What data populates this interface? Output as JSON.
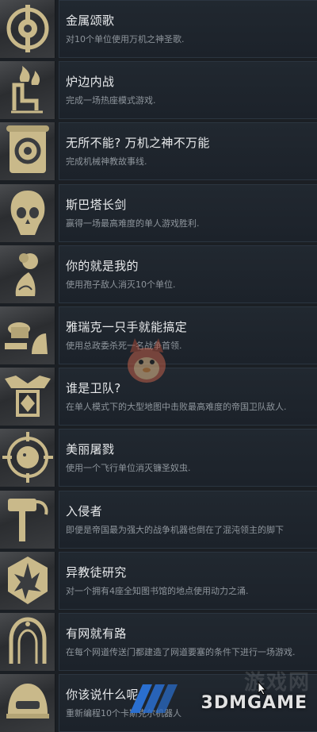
{
  "achievements": [
    {
      "icon": "gear-skull-icon",
      "title": "金属颂歌",
      "description": "对10个单位使用万机之神圣歌."
    },
    {
      "icon": "fire-chair-icon",
      "title": "炉边内战",
      "description": "完成一场热座模式游戏."
    },
    {
      "icon": "scroll-gear-icon",
      "title": "无所不能? 万机之神不万能",
      "description": "完成机械神教故事线."
    },
    {
      "icon": "skull-icon",
      "title": "斯巴塔长剑",
      "description": "赢得一场最高难度的单人游戏胜利."
    },
    {
      "icon": "flower-hand-icon",
      "title": "你的就是我的",
      "description": "使用孢子敌人消灭10个单位."
    },
    {
      "icon": "commissar-icon",
      "title": "雅瑞克一只手就能搞定",
      "description": "使用总政委杀死一名战争首领."
    },
    {
      "icon": "guard-emblem-icon",
      "title": "谁是卫队?",
      "description": "在单人模式下的大型地图中击败最高难度的帝国卫队敌人."
    },
    {
      "icon": "crosshair-beast-icon",
      "title": "美丽屠戮",
      "description": "使用一个飞行单位消灭镰圣奴虫."
    },
    {
      "icon": "hammer-icon",
      "title": "入侵者",
      "description": "即便是帝国最为强大的战争机器也倒在了混沌领主的脚下"
    },
    {
      "icon": "hexagon-shatter-icon",
      "title": "异教徒研究",
      "description": "对一个拥有4座全知图书馆的地点使用动力之涌."
    },
    {
      "icon": "webway-arch-icon",
      "title": "有网就有路",
      "description": "在每个网道传送门都建造了网道要塞的条件下进行一场游戏."
    },
    {
      "icon": "helmet-icon",
      "title": "你该说什么呢",
      "description": "重新编程10个卡斯克尔机器人"
    }
  ],
  "watermark": {
    "brand": "3DMGAME",
    "ghost_text": "游戏网"
  },
  "colors": {
    "panel_bg": "#1f262e",
    "title": "#e8eaec",
    "description": "#8e959c",
    "icon_metal": "#c9b98a"
  }
}
